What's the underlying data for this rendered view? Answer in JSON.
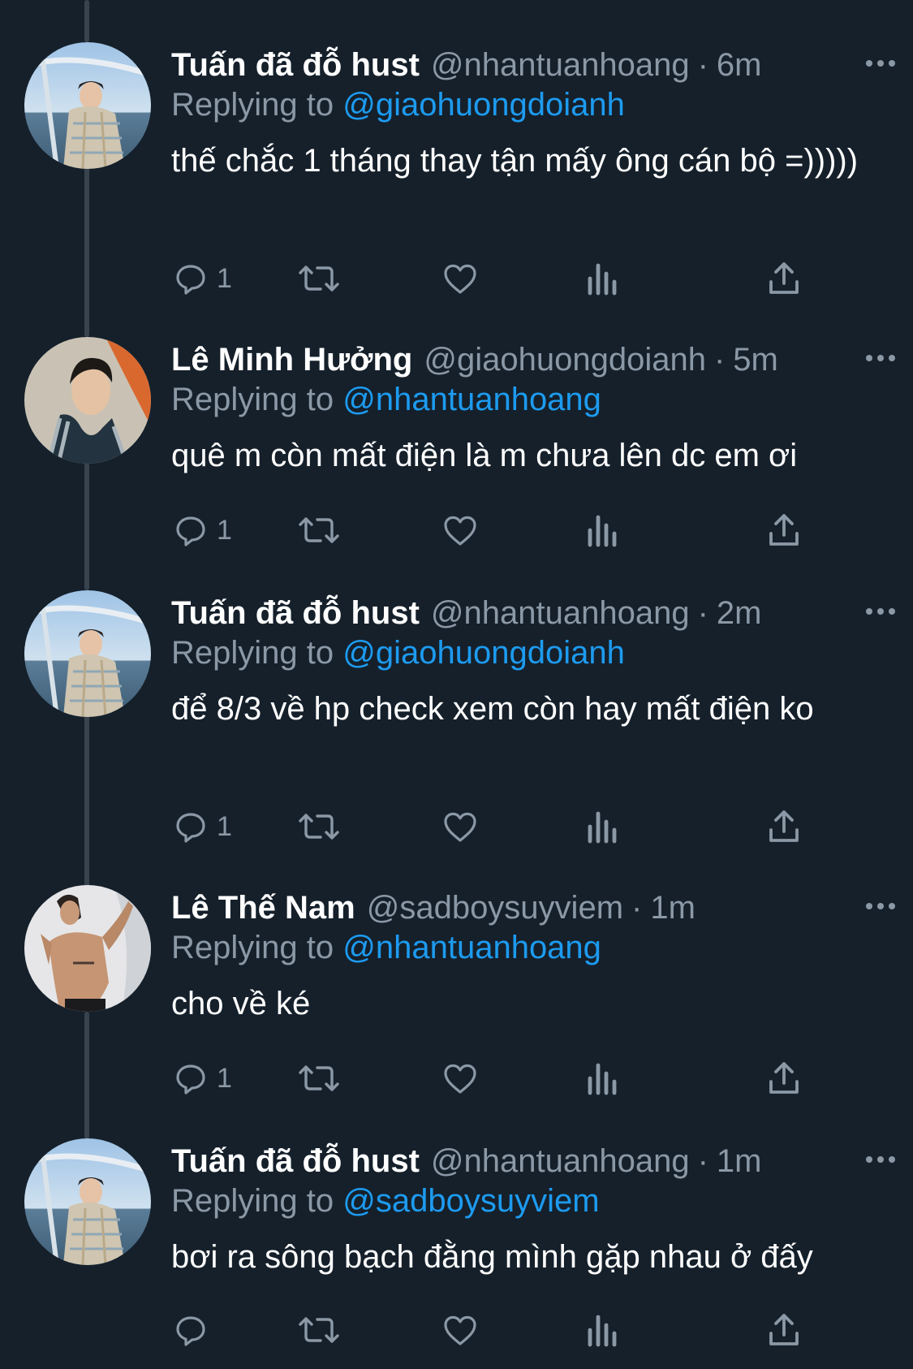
{
  "colors": {
    "background": "#15202b",
    "name": "#ffffff",
    "secondary": "#8b98a5",
    "mention": "#1d9bf0",
    "thread_line": "#38444d"
  },
  "labels": {
    "replying_to": "Replying to",
    "separator": "·"
  },
  "tweets": [
    {
      "name": "Tuấn đã đỗ hust",
      "handle": "@nhantuanhoang",
      "time": "6m",
      "reply_to": "@giaohuongdoianh",
      "text": "thế chắc 1 tháng thay tận mấy ông cán bộ =)))))",
      "reply_count": "1",
      "avatar_icon": "avatar-boat-photo"
    },
    {
      "name": "Lê Minh Hưởng",
      "handle": "@giaohuongdoianh",
      "time": "5m",
      "reply_to": "@nhantuanhoang",
      "text": "quê m còn mất điện là m chưa lên dc em ơi",
      "reply_count": "1",
      "avatar_icon": "avatar-selfie-photo"
    },
    {
      "name": "Tuấn đã đỗ hust",
      "handle": "@nhantuanhoang",
      "time": "2m",
      "reply_to": "@giaohuongdoianh",
      "text": "để 8/3 về hp check xem còn hay mất điện ko",
      "reply_count": "1",
      "avatar_icon": "avatar-boat-photo"
    },
    {
      "name": "Lê Thế Nam",
      "handle": "@sadboysuyviem",
      "time": "1m",
      "reply_to": "@nhantuanhoang",
      "text": "cho về ké",
      "reply_count": "1",
      "avatar_icon": "avatar-shirtless-photo"
    },
    {
      "name": "Tuấn đã đỗ hust",
      "handle": "@nhantuanhoang",
      "time": "1m",
      "reply_to": "@sadboysuyviem",
      "text": "bơi ra sông bạch đằng mình gặp nhau ở đấy",
      "reply_count": "",
      "avatar_icon": "avatar-boat-photo"
    }
  ],
  "action_icons": [
    "reply-icon",
    "retweet-icon",
    "like-icon",
    "views-icon",
    "share-icon"
  ]
}
